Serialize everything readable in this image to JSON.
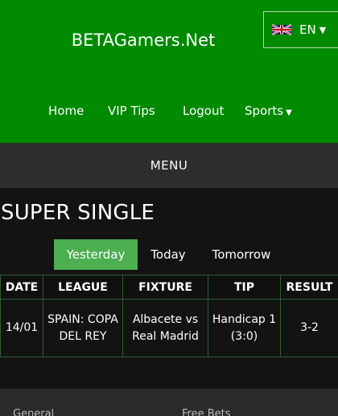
{
  "header": {
    "brand": "BETAGamers.Net",
    "language": {
      "code": "EN",
      "flag_icon": "uk-flag-icon"
    },
    "nav": [
      {
        "label": "Home"
      },
      {
        "label": "VIP Tips"
      },
      {
        "label": "Logout"
      },
      {
        "label": "Sports"
      }
    ],
    "colors": {
      "background": "#008a00"
    }
  },
  "menu_bar": {
    "label": "MENU"
  },
  "main": {
    "title": "SUPER SINGLE",
    "tabs": [
      {
        "label": "Yesterday",
        "active": true
      },
      {
        "label": "Today",
        "active": false
      },
      {
        "label": "Tomorrow",
        "active": false
      }
    ],
    "active_tab_color": "#4caf50",
    "table": {
      "columns": [
        "DATE",
        "LEAGUE",
        "FIXTURE",
        "TIP",
        "RESULT"
      ],
      "rows": [
        {
          "date": "14/01",
          "league": "SPAIN: COPA DEL REY",
          "fixture": "Albacete vs Real Madrid",
          "tip": "Handicap 1 (3:0)",
          "result": "3-2"
        }
      ]
    }
  },
  "footer": {
    "links": [
      {
        "label": "General"
      },
      {
        "label": "Free Bets"
      }
    ]
  }
}
